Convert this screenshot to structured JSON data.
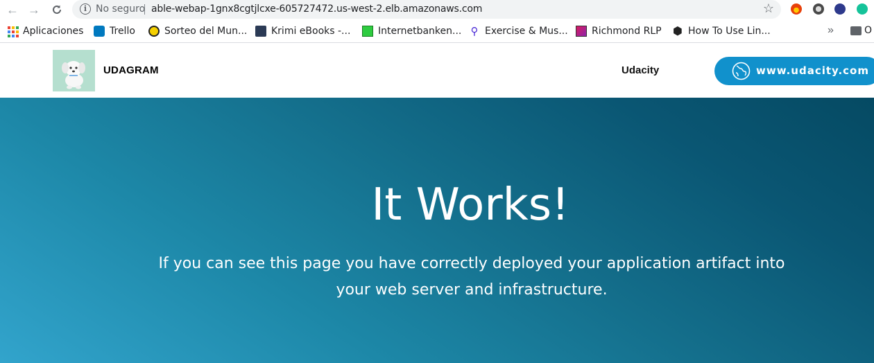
{
  "browser": {
    "security_label": "No seguro",
    "url": "able-webap-1gnx8cgtjlcxe-605727472.us-west-2.elb.amazonaws.com",
    "bookmarks": [
      {
        "label": "Aplicaciones",
        "icon": "apps-grid-icon"
      },
      {
        "label": "Trello",
        "icon": "trello-icon"
      },
      {
        "label": "Sorteo del Mun...",
        "icon": "sorteo-icon"
      },
      {
        "label": "Krimi eBooks -...",
        "icon": "krimi-icon"
      },
      {
        "label": "Internetbanken...",
        "icon": "bank-icon"
      },
      {
        "label": "Exercise & Mus...",
        "icon": "runner-icon"
      },
      {
        "label": "Richmond RLP",
        "icon": "richmond-icon"
      },
      {
        "label": "How To Use Lin...",
        "icon": "hexagon-icon"
      }
    ],
    "more_label": "»",
    "folder_label": "O"
  },
  "site": {
    "brand": "UDAGRAM",
    "nav_link": "Udacity",
    "cta_label": "www.udacity.com"
  },
  "hero": {
    "title": "It Works!",
    "line1": "If you can see this page you have correctly deployed your application artifact into",
    "line2": "your web server and infrastructure."
  },
  "colors": {
    "cta": "#1191cc",
    "hero_start": "#32a4cc",
    "hero_end": "#054a63",
    "logo_bg": "#b5dfcf"
  }
}
